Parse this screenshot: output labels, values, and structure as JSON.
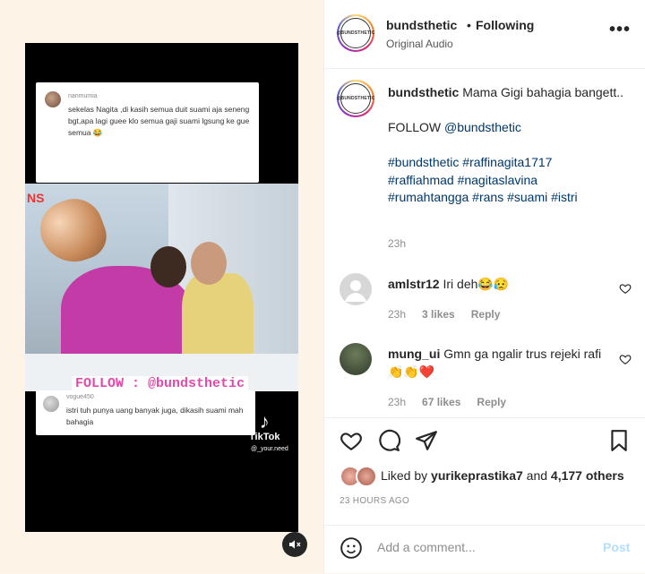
{
  "media": {
    "comment_top": {
      "user": "nanmumia",
      "text": "sekelas Nagita ,di kasih semua duit suami aja seneng bgt,apa lagi guee klo semua gaji suami lgsung ke gue semua 😂"
    },
    "comment_bottom": {
      "user": "vogue450",
      "text": "istri tuh punya uang banyak juga, dikasih suami mah bahagia"
    },
    "brand_fragment": "NS",
    "follow_overlay": "FOLLOW : @bundsthetic",
    "tiktok_logo": "♪",
    "tiktok_label": "TikTok",
    "tiktok_user": "@_your.need",
    "mute_icon": "speaker-muted-icon"
  },
  "header": {
    "avatar_logo_text": "@BUNDSTHETIC",
    "username": "bundsthetic",
    "separator": "•",
    "follow_state": "Following",
    "audio": "Original Audio",
    "more": "•••"
  },
  "caption": {
    "username": "bundsthetic",
    "text": "Mama Gigi bahagia bangett..",
    "follow_line": "FOLLOW ",
    "follow_mention": "@bundsthetic",
    "tags_line1": "#bundsthetic #raffinagita1717",
    "tags_line2": "#raffiahmad #nagitaslavina",
    "tags_line3": "#rumahtangga #rans #suami #istri",
    "time": "23h"
  },
  "comments": [
    {
      "username": "amlstr12",
      "text": "Iri deh😂😥",
      "time": "23h",
      "likes": "3 likes",
      "reply": "Reply"
    },
    {
      "username": "mung_ui",
      "text": "Gmn ga ngalir trus rejeki rafi👏👏❤️",
      "time": "23h",
      "likes": "67 likes",
      "reply": "Reply"
    }
  ],
  "likes": {
    "prefix": "Liked by ",
    "user": "yurikeprastika7",
    "middle": " and ",
    "count": "4,177 others"
  },
  "post_date": "23 HOURS AGO",
  "add_comment": {
    "placeholder": "Add a comment...",
    "post_label": "Post"
  },
  "colors": {
    "link": "#00376b",
    "post_disabled": "#b2dffc",
    "like_red": "#ed4956"
  }
}
